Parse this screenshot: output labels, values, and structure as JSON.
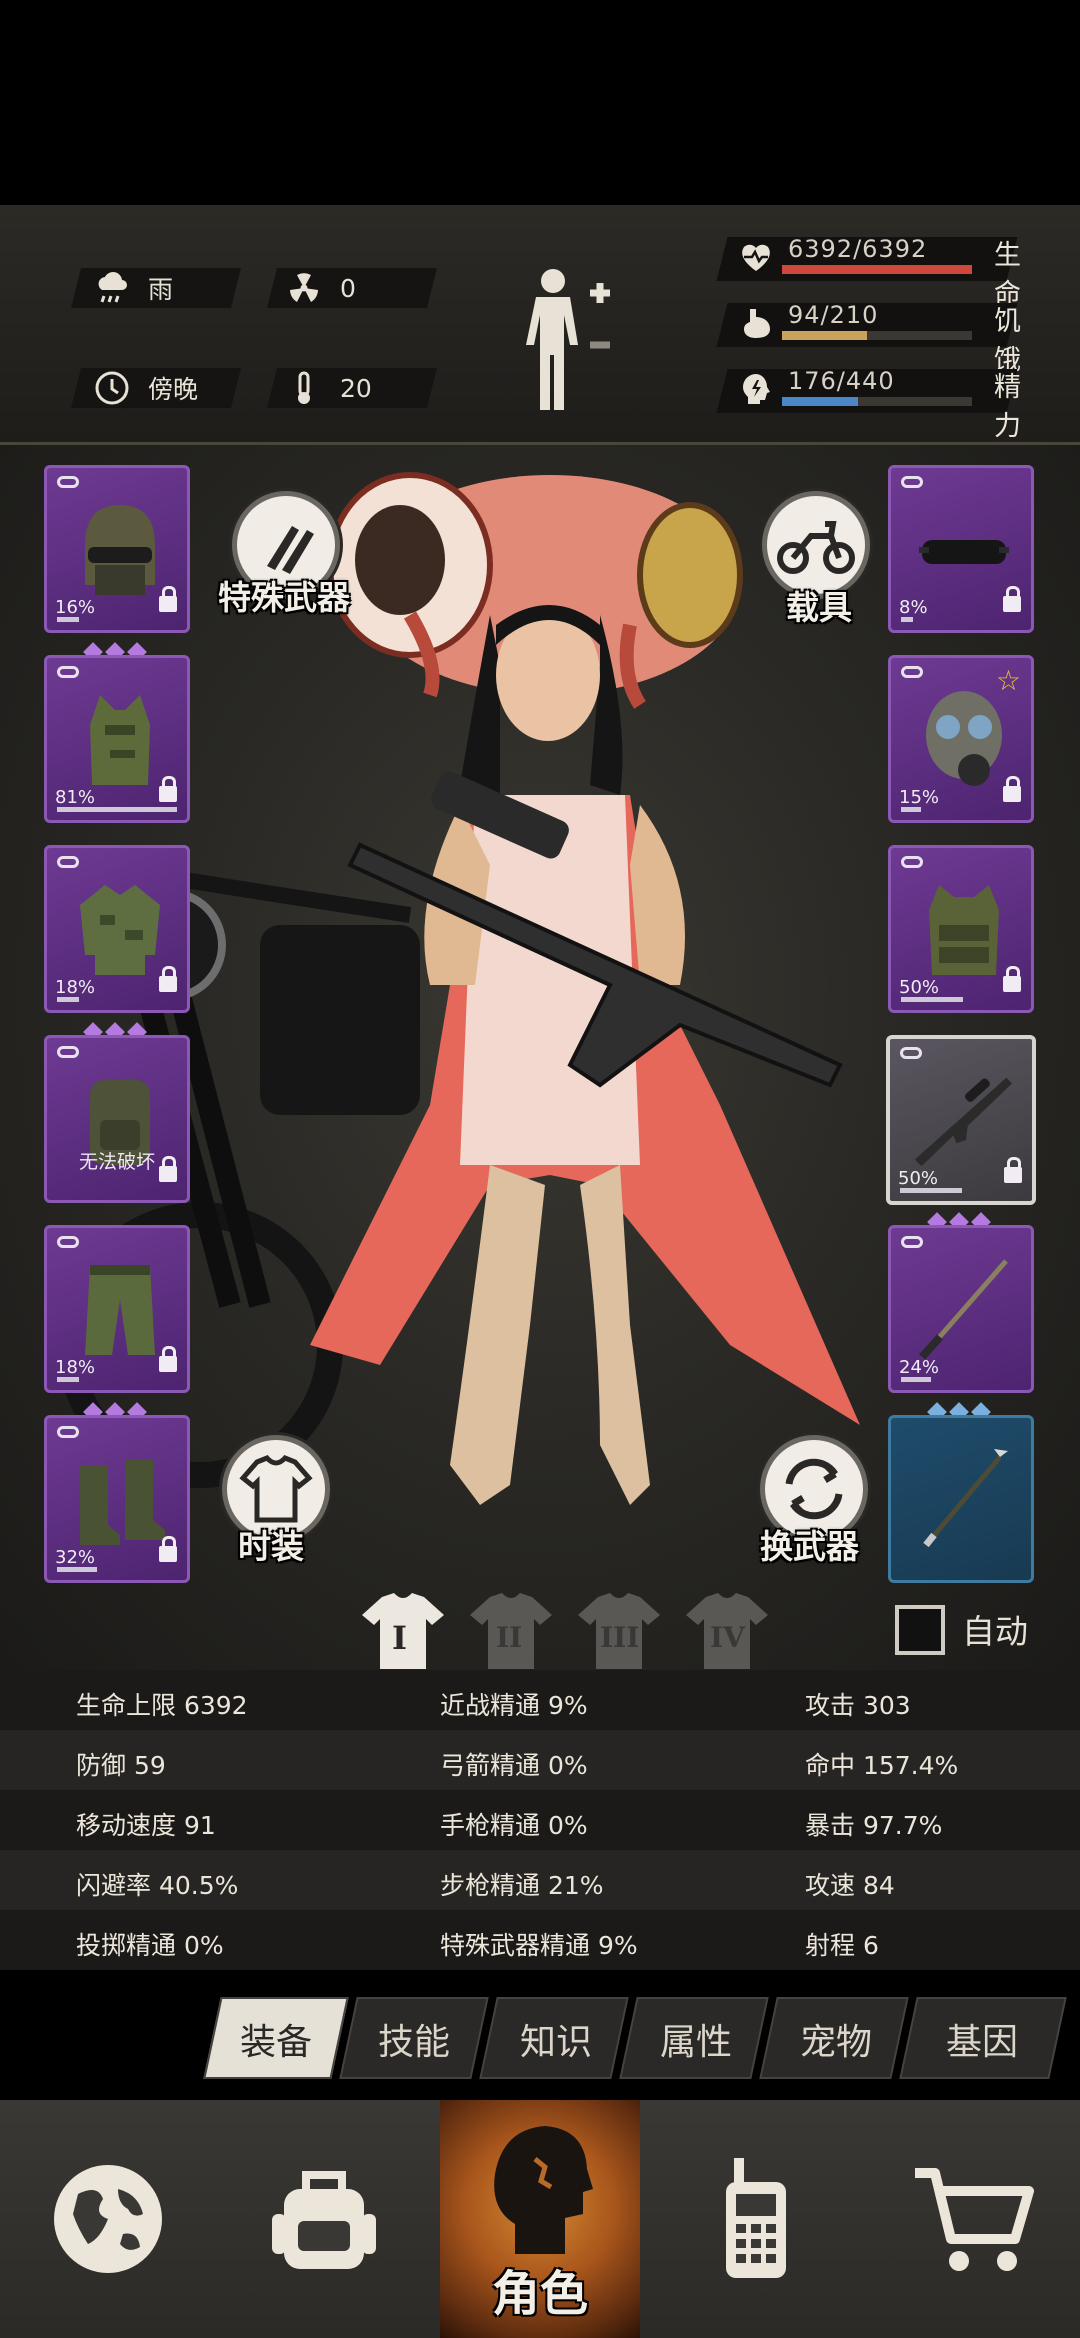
{
  "status": {
    "weather": {
      "icon": "cloud-rain-icon",
      "label": "雨"
    },
    "radiation": {
      "icon": "radiation-icon",
      "value": "0"
    },
    "time": {
      "icon": "clock-icon",
      "label": "傍晚"
    },
    "temperature": {
      "icon": "thermometer-icon",
      "value": "20"
    },
    "health": {
      "value": "6392/6392",
      "label": "生命",
      "fraction": 1.0,
      "color": "#d0483c"
    },
    "hunger": {
      "value": "94/210",
      "label": "饥饿",
      "fraction": 0.448,
      "color": "#c9a25c"
    },
    "energy": {
      "value": "176/440",
      "label": "精力",
      "fraction": 0.4,
      "color": "#4b86c8"
    }
  },
  "buttons": {
    "special_weapon": "特殊武器",
    "vehicle": "载具",
    "fashion": "时装",
    "swap_weapon": "换武器"
  },
  "left_slots": [
    {
      "name": "helmet",
      "durability": "16%",
      "gems": 3
    },
    {
      "name": "vest",
      "durability": "81%",
      "gems": 0
    },
    {
      "name": "jacket",
      "durability": "18%",
      "gems": 3
    },
    {
      "name": "backpack",
      "durability": "",
      "note": "无法破坏",
      "gems": 0
    },
    {
      "name": "pants",
      "durability": "18%",
      "gems": 3
    },
    {
      "name": "boots",
      "durability": "32%",
      "gems": 0
    }
  ],
  "right_slots": [
    {
      "name": "goggles",
      "durability": "8%",
      "gems": 0
    },
    {
      "name": "gas-mask",
      "durability": "15%",
      "gems": 0
    },
    {
      "name": "armor-vest",
      "durability": "50%",
      "gems": 0
    },
    {
      "name": "rifle",
      "durability": "50%",
      "gems": 3
    },
    {
      "name": "katana",
      "durability": "24%",
      "gems": 3
    },
    {
      "name": "spear",
      "durability": "",
      "gems": 0
    }
  ],
  "outfits": [
    "I",
    "II",
    "III",
    "IV"
  ],
  "auto_label": "自动",
  "stats": [
    [
      "生命上限 6392",
      "近战精通 9%",
      "攻击 303"
    ],
    [
      "防御 59",
      "弓箭精通 0%",
      "命中 157.4%"
    ],
    [
      "移动速度 91",
      "手枪精通 0%",
      "暴击 97.7%"
    ],
    [
      "闪避率 40.5%",
      "步枪精通 21%",
      "攻速 84"
    ],
    [
      "投掷精通 0%",
      "特殊武器精通 9%",
      "射程 6"
    ]
  ],
  "tabs": [
    "装备",
    "技能",
    "知识",
    "属性",
    "宠物",
    "基因"
  ],
  "nav": [
    {
      "icon": "globe-icon",
      "label": ""
    },
    {
      "icon": "backpack-icon",
      "label": ""
    },
    {
      "icon": "character-head-icon",
      "label": "角色"
    },
    {
      "icon": "walkie-talkie-icon",
      "label": ""
    },
    {
      "icon": "shopping-cart-icon",
      "label": ""
    }
  ]
}
